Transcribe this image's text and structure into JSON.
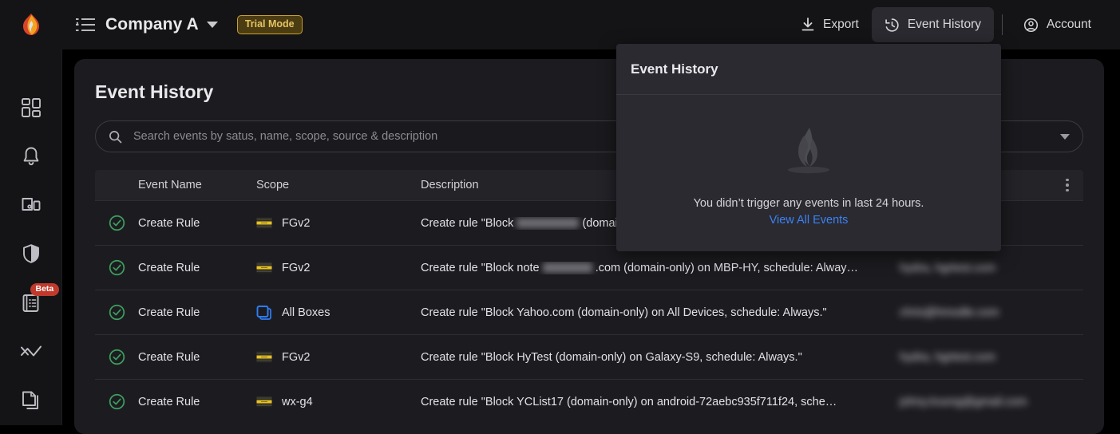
{
  "topbar": {
    "logo_icon": "flame-logo",
    "menu_icon": "list-menu-icon",
    "company": "Company A",
    "trial_badge": "Trial Mode",
    "export_label": "Export",
    "export_icon": "download-icon",
    "event_history_label": "Event History",
    "event_history_icon": "clock-history-icon",
    "account_label": "Account",
    "account_icon": "user-circle-icon"
  },
  "sidebar": {
    "items": [
      {
        "name": "dashboard",
        "icon": "dashboard-grid-icon",
        "badge": ""
      },
      {
        "name": "alerts",
        "icon": "bell-icon",
        "badge": ""
      },
      {
        "name": "devices",
        "icon": "devices-icon",
        "badge": ""
      },
      {
        "name": "security",
        "icon": "shield-icon",
        "badge": ""
      },
      {
        "name": "reports",
        "icon": "list-document-icon",
        "badge": "Beta"
      },
      {
        "name": "analytics",
        "icon": "analytics-line-icon",
        "badge": ""
      },
      {
        "name": "files",
        "icon": "copy-files-icon",
        "badge": ""
      }
    ]
  },
  "main": {
    "title": "Event History",
    "search": {
      "icon": "search-icon",
      "placeholder": "Search events by satus, name, scope, source & description",
      "value": "",
      "filter_icon": "chevron-down-icon"
    },
    "table": {
      "columns": [
        "Event Name",
        "Scope",
        "Description"
      ],
      "menu_icon": "kebab-menu-icon",
      "rows": [
        {
          "status": "success",
          "event_name": "Create Rule",
          "scope": "FGv2",
          "scope_icon": "firewall-box-icon",
          "description_prefix": "Create rule \"Block",
          "description_redacted": true,
          "description_suffix": "(domain",
          "source_redacted": true
        },
        {
          "status": "success",
          "event_name": "Create Rule",
          "scope": "FGv2",
          "scope_icon": "firewall-box-icon",
          "description_prefix": "Create rule \"Block note",
          "description_redacted": true,
          "description_suffix": ".com (domain-only) on MBP-HY, schedule: Alway…",
          "source_redacted": true
        },
        {
          "status": "success",
          "event_name": "Create Rule",
          "scope": "All Boxes",
          "scope_icon": "all-boxes-icon",
          "description_prefix": "Create rule \"Block Yahoo.com (domain-only) on All Devices, schedule: Always.\"",
          "description_redacted": false,
          "description_suffix": "",
          "source_redacted": true
        },
        {
          "status": "success",
          "event_name": "Create Rule",
          "scope": "FGv2",
          "scope_icon": "firewall-box-icon",
          "description_prefix": "Create rule \"Block HyTest (domain-only) on Galaxy-S9, schedule: Always.\"",
          "description_redacted": false,
          "description_suffix": "",
          "source_redacted": true
        },
        {
          "status": "success",
          "event_name": "Create Rule",
          "scope": "wx-g4",
          "scope_icon": "firewall-box-icon",
          "description_prefix": "Create rule \"Block YCList17 (domain-only) on android-72aebc935f711f24, sche…",
          "description_redacted": false,
          "description_suffix": "",
          "source_redacted": true
        }
      ]
    }
  },
  "dropdown": {
    "title": "Event History",
    "empty_icon": "flame-empty-illustration",
    "empty_message": "You didn’t trigger any events in last 24 hours.",
    "link_label": "View All Events"
  },
  "colors": {
    "accent_link": "#3b82f6",
    "success": "#3e9e5f",
    "trial_border": "#c8a02e",
    "trial_text": "#e4c463",
    "beta_badge": "#c0392b",
    "scope_yellow": "#e8c124",
    "scope_blue": "#2f7df6"
  }
}
